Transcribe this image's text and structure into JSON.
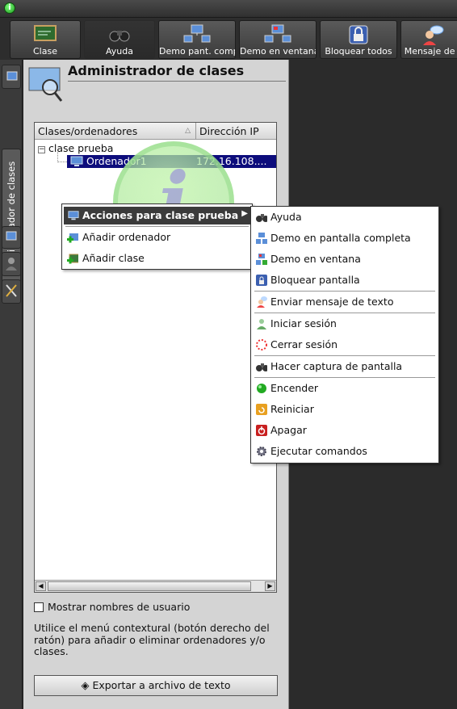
{
  "toolbar": {
    "buttons": [
      {
        "label": "Clase",
        "icon": "chalkboard-icon"
      },
      {
        "label": "Ayuda",
        "icon": "binoculars-icon"
      },
      {
        "label": "Demo pant. comp",
        "icon": "monitors-network-icon"
      },
      {
        "label": "Demo en ventana",
        "icon": "monitors-window-icon"
      },
      {
        "label": "Bloquear todos",
        "icon": "lock-icon"
      },
      {
        "label": "Mensaje de t",
        "icon": "message-user-icon"
      }
    ]
  },
  "sidebar": {
    "tab_label": "Administrador de clases"
  },
  "panel": {
    "title": "Administrador de clases",
    "tree": {
      "columns": [
        "Clases/ordenadores",
        "Dirección IP"
      ],
      "class_name": "clase prueba",
      "computer_name": "Ordenador1",
      "computer_ip": "172.16.108...."
    },
    "show_users_label": "Mostrar nombres de usuario",
    "hint": "Utilice el menú contextural (botón derecho del ratón) para añadir o eliminar ordenadores y/o clases.",
    "export_label": "Exportar a archivo de texto"
  },
  "context_menu": {
    "items": [
      {
        "label": "Acciones para clase prueba",
        "icon": "monitor-icon",
        "selected": true
      },
      {
        "label": "Añadir ordenador",
        "icon": "add-computer-icon"
      },
      {
        "label": "Añadir clase",
        "icon": "add-class-icon"
      }
    ]
  },
  "submenu": {
    "items": [
      {
        "label": "Ayuda",
        "icon": "binoculars-icon"
      },
      {
        "label": "Demo en pantalla completa",
        "icon": "fullscreen-demo-icon"
      },
      {
        "label": "Demo en ventana",
        "icon": "window-demo-icon"
      },
      {
        "label": "Bloquear pantalla",
        "icon": "lock-screen-icon"
      },
      {
        "label": "Enviar mensaje de texto",
        "icon": "message-user-icon"
      },
      {
        "label": "Iniciar sesión",
        "icon": "login-icon"
      },
      {
        "label": "Cerrar sesión",
        "icon": "logout-icon"
      },
      {
        "label": "Hacer captura de pantalla",
        "icon": "camera-icon"
      },
      {
        "label": "Encender",
        "icon": "power-on-icon"
      },
      {
        "label": "Reiniciar",
        "icon": "restart-icon"
      },
      {
        "label": "Apagar",
        "icon": "shutdown-icon"
      },
      {
        "label": "Ejecutar comandos",
        "icon": "gear-icon"
      }
    ]
  },
  "colors": {
    "selection": "#0d0d7c",
    "menu_highlight": "#3b3b3b",
    "toolbar_bg": "#2d2d2d",
    "panel_bg": "#d4d4d4"
  }
}
